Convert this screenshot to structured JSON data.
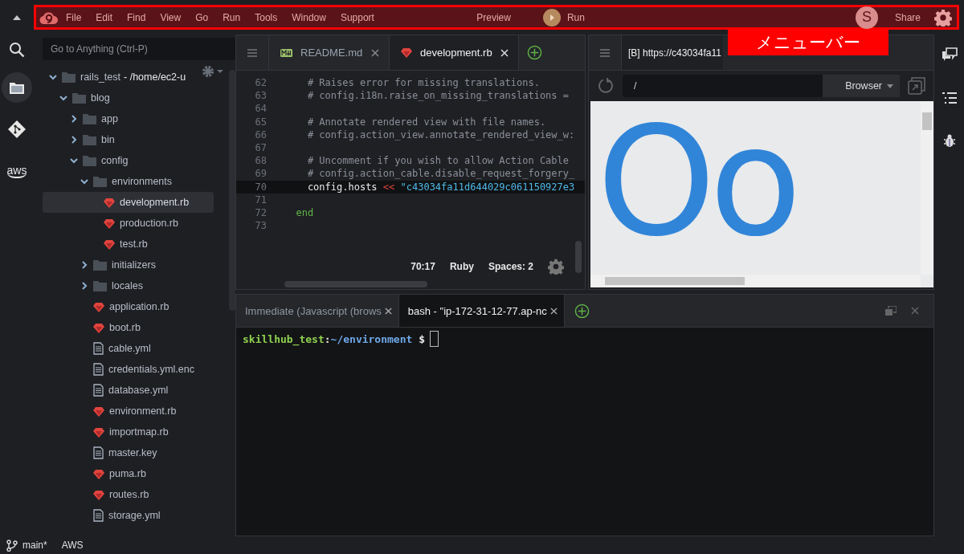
{
  "menu_bar": {
    "items": [
      "File",
      "Edit",
      "Find",
      "View",
      "Go",
      "Run",
      "Tools",
      "Window",
      "Support"
    ],
    "preview": "Preview",
    "run": "Run",
    "avatar": "S",
    "share": "Share"
  },
  "annotation": {
    "label": "メニューバー"
  },
  "activity_bar": {
    "aws": "aws",
    "items": [
      {
        "kind": "files",
        "selected": true
      },
      {
        "kind": "git",
        "selected": false
      },
      {
        "kind": "aws",
        "selected": false
      }
    ]
  },
  "file_tree": {
    "search_placeholder": "Go to Anything (Ctrl-P)",
    "items": [
      {
        "name": "rails_test",
        "suffix": "- /home/ec2-u",
        "kind": "folder",
        "expanded": true,
        "selected": false,
        "children": [
          {
            "name": "blog",
            "kind": "folder",
            "expanded": true,
            "selected": false,
            "children": [
              {
                "name": "app",
                "kind": "folder",
                "expanded": false,
                "selected": false
              },
              {
                "name": "bin",
                "kind": "folder",
                "expanded": false,
                "selected": false
              },
              {
                "name": "config",
                "kind": "folder",
                "expanded": true,
                "selected": false,
                "children": [
                  {
                    "name": "environments",
                    "kind": "folder",
                    "expanded": true,
                    "selected": false,
                    "children": [
                      {
                        "name": "development.rb",
                        "kind": "ruby",
                        "selected": true
                      },
                      {
                        "name": "production.rb",
                        "kind": "ruby",
                        "selected": false
                      },
                      {
                        "name": "test.rb",
                        "kind": "ruby",
                        "selected": false
                      }
                    ]
                  },
                  {
                    "name": "initializers",
                    "kind": "folder",
                    "expanded": false,
                    "selected": false
                  },
                  {
                    "name": "locales",
                    "kind": "folder",
                    "expanded": false,
                    "selected": false
                  },
                  {
                    "name": "application.rb",
                    "kind": "ruby",
                    "selected": false
                  },
                  {
                    "name": "boot.rb",
                    "kind": "ruby",
                    "selected": false
                  },
                  {
                    "name": "cable.yml",
                    "kind": "file",
                    "selected": false
                  },
                  {
                    "name": "credentials.yml.enc",
                    "kind": "file",
                    "selected": false
                  },
                  {
                    "name": "database.yml",
                    "kind": "file",
                    "selected": false
                  },
                  {
                    "name": "environment.rb",
                    "kind": "ruby",
                    "selected": false
                  },
                  {
                    "name": "importmap.rb",
                    "kind": "ruby",
                    "selected": false
                  },
                  {
                    "name": "master.key",
                    "kind": "file",
                    "selected": false
                  },
                  {
                    "name": "puma.rb",
                    "kind": "ruby",
                    "selected": false
                  },
                  {
                    "name": "routes.rb",
                    "kind": "ruby",
                    "selected": false
                  },
                  {
                    "name": "storage.yml",
                    "kind": "file",
                    "selected": false
                  }
                ]
              }
            ]
          }
        ]
      }
    ]
  },
  "editor": {
    "tabs": [
      {
        "label": "README.md",
        "kind": "markdown",
        "selected": false
      },
      {
        "label": "development.rb",
        "kind": "ruby",
        "selected": true
      }
    ],
    "lines": [
      {
        "number": "62",
        "current": false,
        "tokens": [
          {
            "kind": "comment",
            "text": "    # Raises error for missing translations."
          }
        ]
      },
      {
        "number": "63",
        "current": false,
        "tokens": [
          {
            "kind": "comment",
            "text": "    # config.i18n.raise_on_missing_translations ="
          }
        ]
      },
      {
        "number": "64",
        "current": false
      },
      {
        "number": "65",
        "current": false,
        "tokens": [
          {
            "kind": "comment",
            "text": "    # Annotate rendered view with file names."
          }
        ]
      },
      {
        "number": "66",
        "current": false,
        "tokens": [
          {
            "kind": "comment",
            "text": "    # config.action_view.annotate_rendered_view_w:"
          }
        ]
      },
      {
        "number": "67",
        "current": false
      },
      {
        "number": "68",
        "current": false,
        "tokens": [
          {
            "kind": "comment",
            "text": "    # Uncomment if you wish to allow Action Cable"
          }
        ]
      },
      {
        "number": "69",
        "current": false,
        "tokens": [
          {
            "kind": "comment",
            "text": "    # config.action_cable.disable_request_forgery_"
          }
        ]
      },
      {
        "number": "70",
        "current": true,
        "tokens": [
          {
            "kind": "plain",
            "text": "    config.hosts "
          },
          {
            "kind": "operator",
            "text": "<<"
          },
          {
            "kind": "string",
            "text": " \"c43034fa11d644029c061150927e3"
          }
        ]
      },
      {
        "number": "71",
        "current": false
      },
      {
        "number": "72",
        "current": false,
        "tokens": [
          {
            "kind": "keyword",
            "text": "  end"
          }
        ]
      },
      {
        "number": "73",
        "current": false
      }
    ],
    "status": {
      "position": "70:17",
      "language": "Ruby",
      "indent": "Spaces: 2"
    }
  },
  "preview": {
    "tab": "[B] https://c43034fa11",
    "address": "/",
    "mode": "Browser",
    "page_text": "Oo"
  },
  "terminal": {
    "tabs": [
      {
        "label": "Immediate (Javascript (brows",
        "selected": false
      },
      {
        "label": "bash - \"ip-172-31-12-77.ap-nc",
        "selected": true
      }
    ],
    "prompt": {
      "user": "skillhub_test",
      "separator": ":",
      "path": "~/environment",
      "symbol": " $"
    }
  },
  "status_bar": {
    "branch": "main*",
    "aws": "AWS"
  }
}
